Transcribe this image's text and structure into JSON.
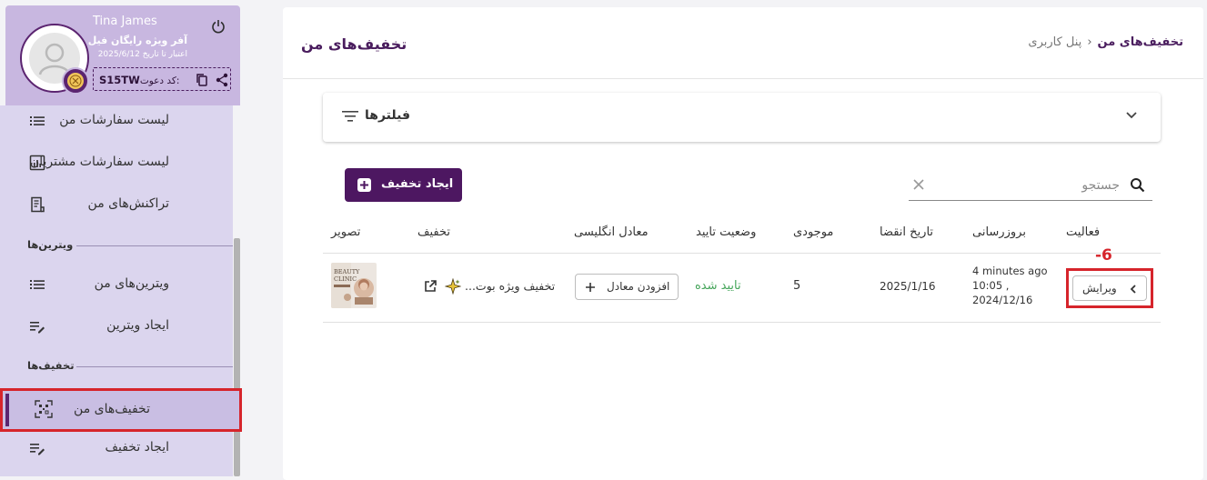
{
  "profile": {
    "name": "Tina James",
    "plan": "آفر ویژه رایگان فیل",
    "validity": "اعتبار تا تاریخ 2025/6/12",
    "invite_label": ":کد دعوت",
    "invite_code": "S15TW"
  },
  "sidebar": {
    "items": [
      {
        "label": "لیست سفارشات من",
        "icon": "list-icon"
      },
      {
        "label": "لیست سفارشات مشتریان",
        "icon": "bar-chart-icon"
      },
      {
        "label": "تراکنش‌های من",
        "icon": "receipt-icon"
      },
      {
        "label": "ویترین‌های من",
        "icon": "list-icon"
      },
      {
        "label": "ایجاد ویترین",
        "icon": "edit-list-icon"
      },
      {
        "label": "تخفیف‌های من",
        "icon": "qr-discount-icon",
        "active": true
      },
      {
        "label": "ایجاد تخفیف",
        "icon": "edit-list-icon"
      }
    ],
    "sections": {
      "showcases": "ویترین‌ها",
      "discounts": "تخفیف‌ها"
    }
  },
  "breadcrumb": {
    "current": "تخفیف‌های من",
    "root": "پنل کاربری"
  },
  "page_title": "تخفیف‌های من",
  "filters": {
    "label": "فیلترها"
  },
  "create_button": {
    "label": "ایجاد تخفیف"
  },
  "search": {
    "placeholder": "جستجو",
    "value": ""
  },
  "table": {
    "headers": {
      "activity": "فعالیت",
      "updated": "بروزرسانی",
      "expiry": "تاریخ انقضا",
      "stock": "موجودی",
      "status": "وضعیت تایید",
      "english": "معادل انگلیسی",
      "discount": "تخفیف",
      "image": "تصویر"
    },
    "rows": [
      {
        "edit_label": "ویرایش",
        "updated_line1": "4 minutes ago",
        "updated_line2": "10:05 ,",
        "updated_line3": "2024/12/16",
        "expiry": "2025/1/16",
        "stock": "5",
        "status": "تایید شده",
        "add_equivalent_label": "افزودن معادل",
        "discount_name": "تخفیف ویژه بوت...",
        "thumb_line1": "BEAUTY",
        "thumb_line2": "CLINIC"
      }
    ]
  },
  "annotation": {
    "step": "-6"
  },
  "colors": {
    "brand": "#4d1761",
    "sidebar_bg": "#dbd5ee",
    "profile_bg": "#c8b7e0",
    "highlight": "#d6242b",
    "status_ok": "#45a55a"
  }
}
